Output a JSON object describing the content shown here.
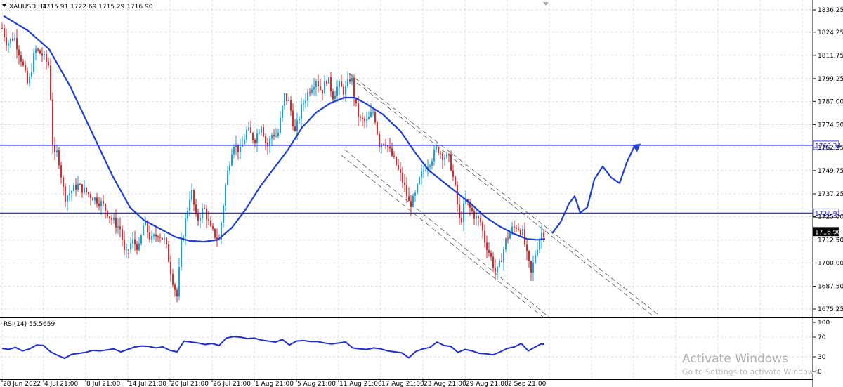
{
  "window": {
    "symbol": "XAUUSD,H4",
    "ohlc": "1715.91 1722.69 1715.29 1716.90",
    "rsi_label": "RSI(14) 55.5659"
  },
  "watermark": {
    "line1": "Activate Windows",
    "line2": "Go to Settings to activate Windows."
  },
  "colors": {
    "bull": "#1a9fe0",
    "bear": "#e0262b",
    "ma": "#1f3fd6",
    "level": "#1a1ad0",
    "projection": "#1f3fd6",
    "grid": "#cfcfcf",
    "channel": "#555555",
    "rsi": "#1f2fd6"
  },
  "chart_data": [
    {
      "type": "candlestick",
      "title": "XAUUSD,H4",
      "x_tick_labels": [
        "28 Jun 2022",
        "4 Jul 21:00",
        "8 Jul 21:00",
        "14 Jul 21:00",
        "20 Jul 21:00",
        "26 Jul 21:00",
        "1 Aug 21:00",
        "5 Aug 21:00",
        "11 Aug 21:00",
        "17 Aug 21:00",
        "23 Aug 21:00",
        "29 Aug 21:00",
        "2 Sep 21:00"
      ],
      "y_ticks": [
        1836.25,
        1824.25,
        1811.75,
        1799.25,
        1787.0,
        1774.5,
        1762.25,
        1749.75,
        1737.25,
        1725.0,
        1712.5,
        1700.0,
        1687.5,
        1675.25
      ],
      "ylim": [
        1670.4,
        1842.3
      ],
      "price_path": [
        [
          0,
          1830
        ],
        [
          10,
          1818
        ],
        [
          20,
          1822
        ],
        [
          30,
          1810
        ],
        [
          40,
          1795
        ],
        [
          50,
          1815
        ],
        [
          60,
          1812
        ],
        [
          70,
          1806
        ],
        [
          76,
          1756
        ],
        [
          82,
          1760
        ],
        [
          92,
          1735
        ],
        [
          110,
          1742
        ],
        [
          130,
          1736
        ],
        [
          145,
          1732
        ],
        [
          158,
          1724
        ],
        [
          172,
          1718
        ],
        [
          178,
          1703
        ],
        [
          188,
          1712
        ],
        [
          198,
          1708
        ],
        [
          205,
          1722
        ],
        [
          215,
          1712
        ],
        [
          225,
          1716
        ],
        [
          235,
          1712
        ],
        [
          245,
          1692
        ],
        [
          252,
          1682
        ],
        [
          258,
          1710
        ],
        [
          265,
          1725
        ],
        [
          272,
          1740
        ],
        [
          280,
          1722
        ],
        [
          290,
          1730
        ],
        [
          300,
          1718
        ],
        [
          312,
          1712
        ],
        [
          322,
          1745
        ],
        [
          332,
          1765
        ],
        [
          342,
          1760
        ],
        [
          352,
          1772
        ],
        [
          362,
          1766
        ],
        [
          372,
          1775
        ],
        [
          380,
          1762
        ],
        [
          388,
          1770
        ],
        [
          395,
          1768
        ],
        [
          405,
          1790
        ],
        [
          412,
          1786
        ],
        [
          420,
          1770
        ],
        [
          430,
          1785
        ],
        [
          440,
          1793
        ],
        [
          450,
          1799
        ],
        [
          458,
          1792
        ],
        [
          466,
          1800
        ],
        [
          474,
          1790
        ],
        [
          482,
          1796
        ],
        [
          490,
          1792
        ],
        [
          500,
          1801
        ],
        [
          506,
          1785
        ],
        [
          512,
          1777
        ],
        [
          522,
          1776
        ],
        [
          532,
          1782
        ],
        [
          540,
          1764
        ],
        [
          548,
          1766
        ],
        [
          555,
          1760
        ],
        [
          565,
          1752
        ],
        [
          575,
          1742
        ],
        [
          583,
          1731
        ],
        [
          590,
          1735
        ],
        [
          598,
          1746
        ],
        [
          606,
          1752
        ],
        [
          614,
          1756
        ],
        [
          622,
          1762
        ],
        [
          630,
          1758
        ],
        [
          640,
          1756
        ],
        [
          648,
          1740
        ],
        [
          655,
          1720
        ],
        [
          662,
          1734
        ],
        [
          668,
          1730
        ],
        [
          676,
          1725
        ],
        [
          684,
          1722
        ],
        [
          690,
          1712
        ],
        [
          698,
          1704
        ],
        [
          706,
          1694
        ],
        [
          712,
          1700
        ],
        [
          720,
          1712
        ],
        [
          728,
          1718
        ],
        [
          736,
          1720
        ],
        [
          744,
          1716
        ],
        [
          750,
          1704
        ],
        [
          756,
          1694
        ],
        [
          762,
          1705
        ],
        [
          770,
          1716
        ],
        [
          776,
          1717
        ]
      ],
      "ma_points": [
        [
          5,
          1833
        ],
        [
          40,
          1825
        ],
        [
          70,
          1815
        ],
        [
          100,
          1795
        ],
        [
          130,
          1771
        ],
        [
          160,
          1747
        ],
        [
          185,
          1730
        ],
        [
          205,
          1723
        ],
        [
          230,
          1718
        ],
        [
          250,
          1714
        ],
        [
          270,
          1712
        ],
        [
          290,
          1711.5
        ],
        [
          310,
          1712.5
        ],
        [
          330,
          1719
        ],
        [
          350,
          1729
        ],
        [
          370,
          1741
        ],
        [
          390,
          1751
        ],
        [
          410,
          1761
        ],
        [
          430,
          1773
        ],
        [
          450,
          1781
        ],
        [
          470,
          1786
        ],
        [
          490,
          1789
        ],
        [
          505,
          1789
        ],
        [
          520,
          1786
        ],
        [
          545,
          1780
        ],
        [
          570,
          1771
        ],
        [
          590,
          1760
        ],
        [
          610,
          1750
        ],
        [
          630,
          1744
        ],
        [
          650,
          1738
        ],
        [
          670,
          1732
        ],
        [
          690,
          1725
        ],
        [
          710,
          1720
        ],
        [
          730,
          1716
        ],
        [
          750,
          1713
        ],
        [
          765,
          1712.5
        ],
        [
          776,
          1713
        ]
      ],
      "levels": [
        {
          "value": 1763.34,
          "label": "1763.34"
        },
        {
          "value": 1726.91,
          "label": "1726.91"
        },
        {
          "value": 1716.9,
          "label": "1716.90"
        }
      ],
      "channel_upper": [
        [
          [
            497,
            1802
          ],
          [
            938,
            1672
          ]
        ],
        [
          [
            508,
            1797
          ],
          [
            928,
            1672
          ]
        ]
      ],
      "channel_lower": [
        [
          [
            486,
            1758
          ],
          [
            776,
            1670
          ]
        ],
        [
          [
            491,
            1761
          ],
          [
            781,
            1671
          ]
        ]
      ],
      "projection": [
        [
          786,
          1716
        ],
        [
          798,
          1722
        ],
        [
          810,
          1732
        ],
        [
          818,
          1736
        ],
        [
          826,
          1727
        ],
        [
          836,
          1730
        ],
        [
          846,
          1745
        ],
        [
          858,
          1752
        ],
        [
          870,
          1746
        ],
        [
          882,
          1743
        ],
        [
          892,
          1754
        ],
        [
          902,
          1762
        ],
        [
          910,
          1763.5
        ]
      ]
    },
    {
      "type": "line",
      "title": "RSI(14) 55.5659",
      "y_ticks": [
        100,
        70,
        30,
        0
      ],
      "ylim": [
        0,
        100
      ],
      "values": [
        [
          3,
          47
        ],
        [
          12,
          45
        ],
        [
          22,
          49
        ],
        [
          32,
          42
        ],
        [
          42,
          46
        ],
        [
          52,
          54
        ],
        [
          62,
          53
        ],
        [
          72,
          40
        ],
        [
          82,
          33
        ],
        [
          92,
          27
        ],
        [
          102,
          35
        ],
        [
          112,
          37
        ],
        [
          122,
          39
        ],
        [
          132,
          43
        ],
        [
          142,
          42
        ],
        [
          152,
          44
        ],
        [
          162,
          46
        ],
        [
          172,
          40
        ],
        [
          182,
          45
        ],
        [
          192,
          50
        ],
        [
          202,
          52
        ],
        [
          212,
          51
        ],
        [
          222,
          48
        ],
        [
          232,
          50
        ],
        [
          242,
          43
        ],
        [
          252,
          40
        ],
        [
          262,
          62
        ],
        [
          272,
          60
        ],
        [
          282,
          58
        ],
        [
          292,
          55
        ],
        [
          302,
          57
        ],
        [
          312,
          53
        ],
        [
          322,
          68
        ],
        [
          332,
          71
        ],
        [
          342,
          70
        ],
        [
          352,
          67
        ],
        [
          362,
          68
        ],
        [
          372,
          64
        ],
        [
          382,
          62
        ],
        [
          392,
          60
        ],
        [
          402,
          65
        ],
        [
          412,
          54
        ],
        [
          422,
          62
        ],
        [
          432,
          63
        ],
        [
          442,
          61
        ],
        [
          452,
          61
        ],
        [
          462,
          58
        ],
        [
          472,
          56
        ],
        [
          482,
          58
        ],
        [
          492,
          60
        ],
        [
          502,
          48
        ],
        [
          512,
          46
        ],
        [
          522,
          45
        ],
        [
          532,
          48
        ],
        [
          542,
          46
        ],
        [
          552,
          42
        ],
        [
          562,
          40
        ],
        [
          572,
          38
        ],
        [
          582,
          28
        ],
        [
          592,
          41
        ],
        [
          602,
          46
        ],
        [
          612,
          49
        ],
        [
          622,
          60
        ],
        [
          632,
          53
        ],
        [
          642,
          51
        ],
        [
          652,
          39
        ],
        [
          662,
          45
        ],
        [
          672,
          42
        ],
        [
          682,
          37
        ],
        [
          692,
          36
        ],
        [
          702,
          34
        ],
        [
          712,
          40
        ],
        [
          722,
          47
        ],
        [
          732,
          50
        ],
        [
          742,
          57
        ],
        [
          752,
          42
        ],
        [
          762,
          50
        ],
        [
          770,
          56
        ],
        [
          775,
          55.5659
        ]
      ]
    }
  ]
}
